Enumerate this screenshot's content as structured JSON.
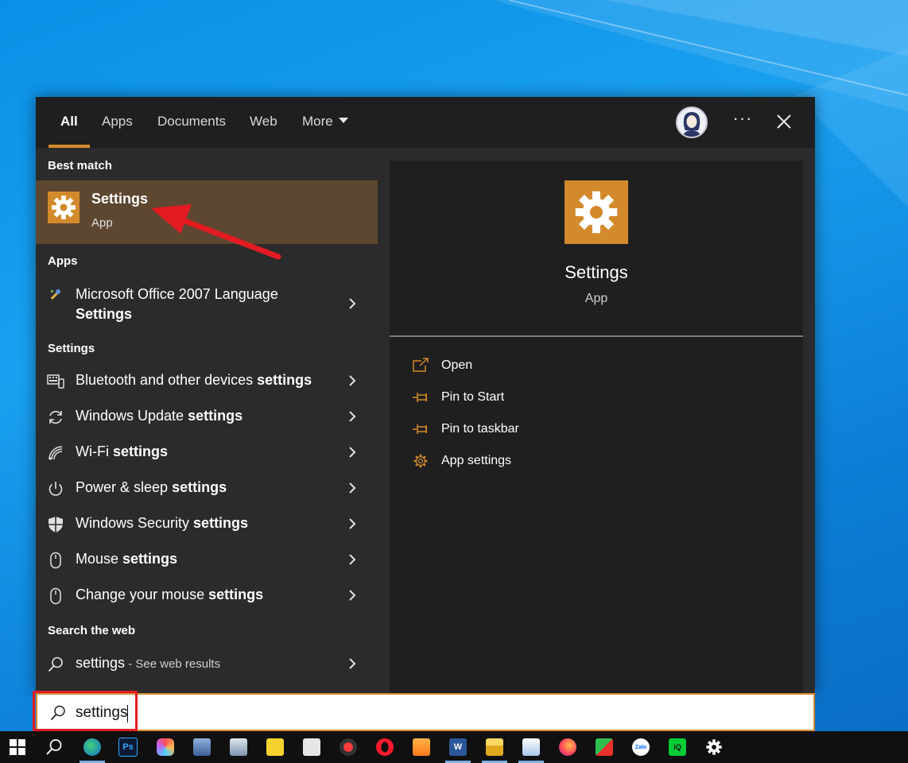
{
  "tabs": [
    {
      "label": "All",
      "active": true
    },
    {
      "label": "Apps",
      "active": false
    },
    {
      "label": "Documents",
      "active": false
    },
    {
      "label": "Web",
      "active": false
    },
    {
      "label": "More",
      "active": false
    }
  ],
  "top_bar": {
    "more_options_label": "···"
  },
  "best_match": {
    "header": "Best match",
    "title": "Settings",
    "subtitle": "App"
  },
  "apps_section": {
    "header": "Apps",
    "item_line1": "Microsoft Office 2007 Language",
    "item_line2": "Settings"
  },
  "settings_section": {
    "header": "Settings",
    "items": [
      {
        "prefix": "Bluetooth and other devices ",
        "bold": "settings",
        "icon": "keyboard-device-icon"
      },
      {
        "prefix": "Windows Update ",
        "bold": "settings",
        "icon": "refresh-icon"
      },
      {
        "prefix": "Wi-Fi ",
        "bold": "settings",
        "icon": "wifi-icon"
      },
      {
        "prefix": "Power & sleep ",
        "bold": "settings",
        "icon": "power-icon"
      },
      {
        "prefix": "Windows Security ",
        "bold": "settings",
        "icon": "shield-icon"
      },
      {
        "prefix": "Mouse ",
        "bold": "settings",
        "icon": "mouse-icon"
      },
      {
        "prefix": "Change your mouse ",
        "bold": "settings",
        "icon": "mouse-icon"
      }
    ]
  },
  "web_section": {
    "header": "Search the web",
    "query": "settings",
    "suffix": " - See web results"
  },
  "detail": {
    "title": "Settings",
    "subtitle": "App",
    "actions": [
      {
        "label": "Open",
        "icon": "open-icon"
      },
      {
        "label": "Pin to Start",
        "icon": "pin-icon"
      },
      {
        "label": "Pin to taskbar",
        "icon": "pin-icon"
      },
      {
        "label": "App settings",
        "icon": "gear-icon"
      }
    ]
  },
  "search": {
    "value": "settings"
  },
  "colors": {
    "accent": "#d38a2c",
    "highlight_row": "#5e4730",
    "annotation_red": "#e21b22"
  },
  "taskbar": {
    "apps": [
      {
        "icon": "windows-start-icon"
      },
      {
        "icon": "search-icon"
      },
      {
        "icon": "edge-icon",
        "text": ""
      },
      {
        "icon": "photoshop-icon",
        "text": "Ps"
      },
      {
        "icon": "creative-cloud-icon",
        "text": ""
      },
      {
        "icon": "game-icon",
        "text": ""
      },
      {
        "icon": "photo-viewer-icon",
        "text": ""
      },
      {
        "icon": "sticky-notes-icon",
        "text": ""
      },
      {
        "icon": "remote-desktop-icon",
        "text": ""
      },
      {
        "icon": "screen-recorder-icon",
        "text": ""
      },
      {
        "icon": "opera-icon",
        "text": ""
      },
      {
        "icon": "media-player-icon",
        "text": ""
      },
      {
        "icon": "word-icon",
        "text": "W"
      },
      {
        "icon": "file-explorer-icon",
        "text": ""
      },
      {
        "icon": "paint-icon",
        "text": ""
      },
      {
        "icon": "firefox-icon",
        "text": ""
      },
      {
        "icon": "wps-icon",
        "text": ""
      },
      {
        "icon": "zalo-icon",
        "text": "Zalo"
      },
      {
        "icon": "iqiyi-icon",
        "text": "iQ"
      },
      {
        "icon": "settings-icon",
        "text": ""
      }
    ]
  }
}
